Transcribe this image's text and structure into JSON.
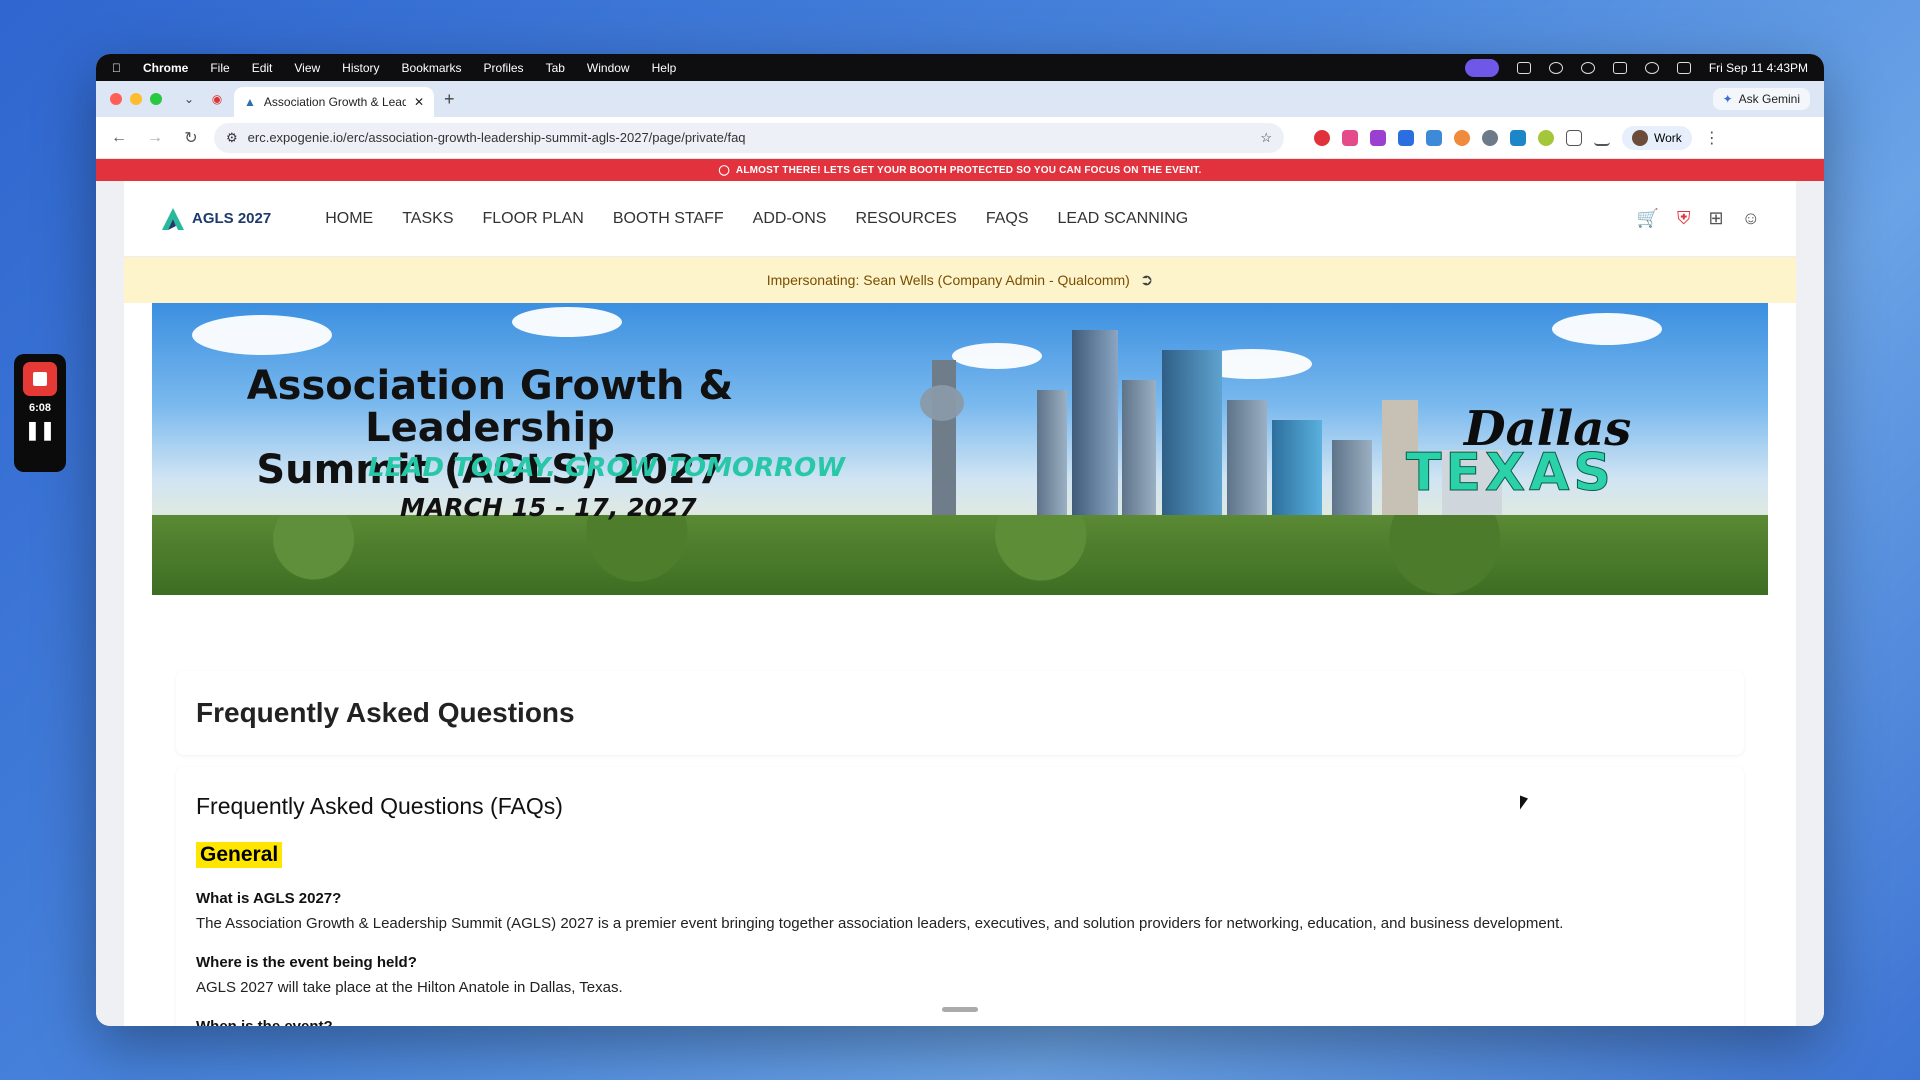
{
  "menubar": {
    "app": "Chrome",
    "items": [
      "File",
      "Edit",
      "View",
      "History",
      "Bookmarks",
      "Profiles",
      "Tab",
      "Window",
      "Help"
    ],
    "clock": "Fri Sep 11  4:43PM"
  },
  "browser": {
    "tab_title": "Association Growth & Leader",
    "ask_gemini": "Ask Gemini",
    "url": "erc.expogenie.io/erc/association-growth-leadership-summit-agls-2027/page/private/faq",
    "profile": "Work",
    "new_tab": "+"
  },
  "alert": "ALMOST THERE! LETS GET YOUR BOOTH PROTECTED SO YOU CAN FOCUS ON THE EVENT.",
  "site": {
    "logo": "AGLS 2027",
    "nav": [
      "HOME",
      "TASKS",
      "FLOOR PLAN",
      "BOOTH STAFF",
      "ADD-ONS",
      "RESOURCES",
      "FAQS",
      "LEAD SCANNING"
    ],
    "impersonating": "Impersonating: Sean Wells (Company Admin - Qualcomm)"
  },
  "hero": {
    "title_line1": "Association Growth & Leadership",
    "title_line2": "Summit (AGLS) 2027",
    "tagline": "LEAD TODAY. GROW TOMORROW",
    "dates": "MARCH 15 - 17, 2027",
    "city": "Dallas",
    "state": "TEXAS"
  },
  "faq": {
    "page_title": "Frequently Asked Questions",
    "heading": "Frequently Asked Questions (FAQs)",
    "section": "General",
    "items": [
      {
        "q": "What is AGLS 2027?",
        "a": "The Association Growth & Leadership Summit (AGLS) 2027 is a premier event bringing together association leaders, executives, and solution providers for networking, education, and business development."
      },
      {
        "q": "Where is the event being held?",
        "a": "AGLS 2027 will take place at the Hilton Anatole in Dallas, Texas."
      },
      {
        "q": "When is the event?",
        "a": ""
      }
    ]
  },
  "recorder": {
    "time": "6:08"
  },
  "colors": {
    "alert": "#e2323d",
    "highlight": "#ffe600",
    "impersonate_bg": "#fdf4cc",
    "accent_teal": "#2bd2a9"
  }
}
